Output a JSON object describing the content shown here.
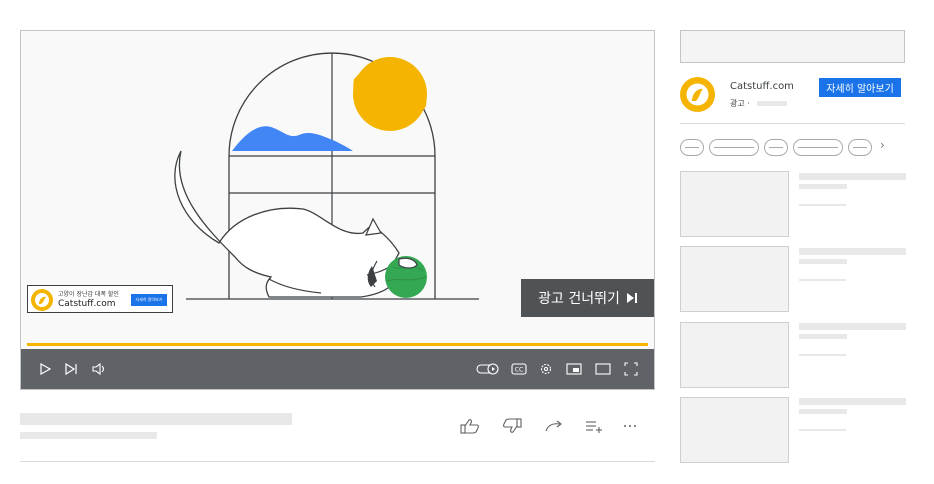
{
  "overlay_ad": {
    "tagline": "고양이 장난감 대폭 할인",
    "domain": "Catstuff.com",
    "button_label": "자세히 알아보기"
  },
  "skip_ad": {
    "label": "광고 건너뛰기",
    "icon": "skip-next-icon"
  },
  "player": {
    "progress_fraction": 1.0,
    "progress_color": "#f4b400",
    "controls_left": [
      "play-icon",
      "next-icon",
      "volume-icon"
    ],
    "controls_right": [
      "autoplay-toggle-icon",
      "captions-icon",
      "settings-icon",
      "miniplayer-icon",
      "theater-mode-icon",
      "fullscreen-icon"
    ],
    "captions_label": "CC"
  },
  "video_actions": [
    "like-icon",
    "dislike-icon",
    "share-icon",
    "save-to-playlist-icon",
    "more-icon"
  ],
  "sidebar": {
    "ad_card": {
      "domain": "Catstuff.com",
      "ad_label": "광고 ·",
      "button_label": "자세히 알아보기"
    },
    "chips_arrow": "›"
  },
  "colors": {
    "accent_blue": "#1a73e8",
    "brand_yellow": "#f4b400",
    "ball_green": "#34a853",
    "cloud_blue": "#4285f4",
    "controls_bar": "#5f6368"
  }
}
